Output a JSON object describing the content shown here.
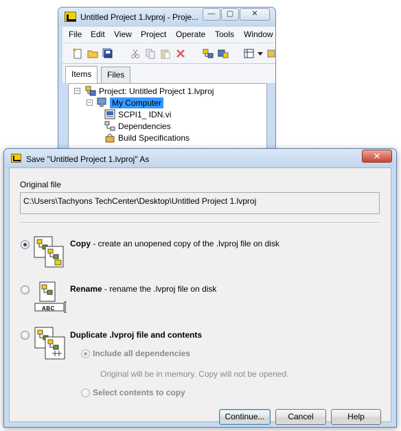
{
  "project_window": {
    "title": "Untitled Project 1.lvproj - Proje...",
    "controls": {
      "minimize": "—",
      "maximize": "▢",
      "close": "✕"
    },
    "menu": [
      "File",
      "Edit",
      "View",
      "Project",
      "Operate",
      "Tools",
      "Window"
    ],
    "tabs": {
      "items": "Items",
      "files": "Files"
    },
    "tree": {
      "root": "Project: Untitled Project 1.lvproj",
      "computer": "My Computer",
      "vi": "SCPI1_ IDN.vi",
      "dependencies": "Dependencies",
      "build_specs": "Build Specifications"
    }
  },
  "dialog": {
    "title": "Save \"Untitled Project 1.lvproj\" As",
    "close_glyph": "✕",
    "original_file_label": "Original file",
    "original_file_path": "C:\\Users\\Tachyons TechCenter\\Desktop\\Untitled Project 1.lvproj",
    "options": {
      "copy": {
        "label": "Copy",
        "desc": " - create an unopened copy of the .lvproj file on disk",
        "selected": true
      },
      "rename": {
        "label": "Rename",
        "desc": " - rename the .lvproj file on disk",
        "selected": false
      },
      "duplicate": {
        "label": "Duplicate .lvproj file and contents",
        "selected": false
      }
    },
    "suboptions": {
      "include_all": "Include all dependencies",
      "include_note": "Original will be in memory. Copy will not be opened.",
      "select_contents": "Select contents to copy"
    },
    "rename_icon_text": "ABC",
    "buttons": {
      "continue": "Continue...",
      "cancel": "Cancel",
      "help": "Help"
    }
  },
  "colors": {
    "selection": "#3399ff",
    "title_bar": "#c8daee",
    "close_red": "#c8442e"
  }
}
